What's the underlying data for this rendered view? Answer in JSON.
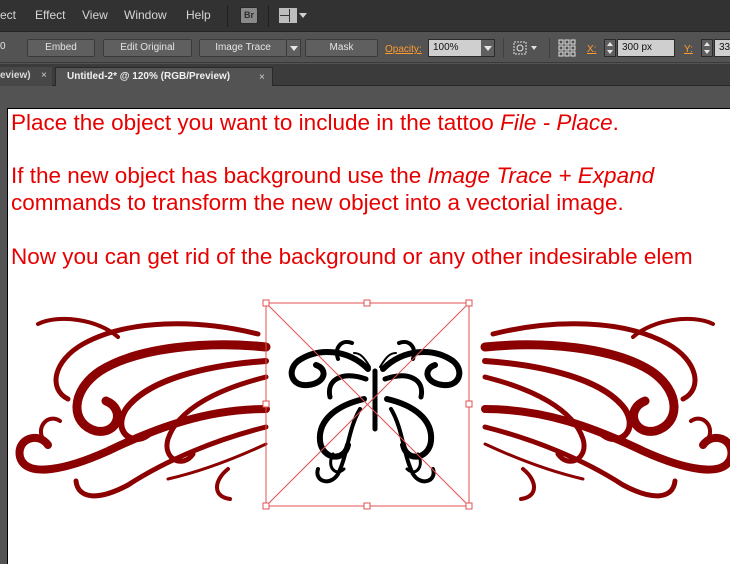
{
  "menubar": {
    "items": [
      "ect",
      "Effect",
      "View",
      "Window",
      "Help"
    ],
    "bridge_label": "Br"
  },
  "controlbar": {
    "first_value": "0",
    "embed": "Embed",
    "edit_original": "Edit Original",
    "image_trace": "Image Trace",
    "mask": "Mask",
    "opacity_label": "Opacity:",
    "opacity_value": "100%",
    "x_label": "X:",
    "x_value": "300 px",
    "y_label": "Y:",
    "y_value": "33"
  },
  "tabs": [
    {
      "label": "eview)",
      "close": "×",
      "active": false
    },
    {
      "label": "Untitled-2* @ 120% (RGB/Preview)",
      "close": "×",
      "active": true
    }
  ],
  "document": {
    "line1_prefix": "Place the object you want to include in the tattoo ",
    "line1_italic": "File - Place",
    "line1_suffix": ".",
    "line2_prefix": "If the new object has background use the ",
    "line2_italic": "Image Trace + Expand",
    "line3": "commands to transform the new object into a vectorial image.",
    "line4": "Now you can get rid of the background or any other indesirable elem"
  },
  "colors": {
    "instruction_text": "#e60000",
    "ornament": "#8b0000",
    "selection": "#e05050",
    "accent_label": "#ff9b2e"
  },
  "icons": [
    "bridge-icon",
    "arrange-documents-icon",
    "chevron-down-icon",
    "target-icon",
    "transform-reference-icon"
  ]
}
